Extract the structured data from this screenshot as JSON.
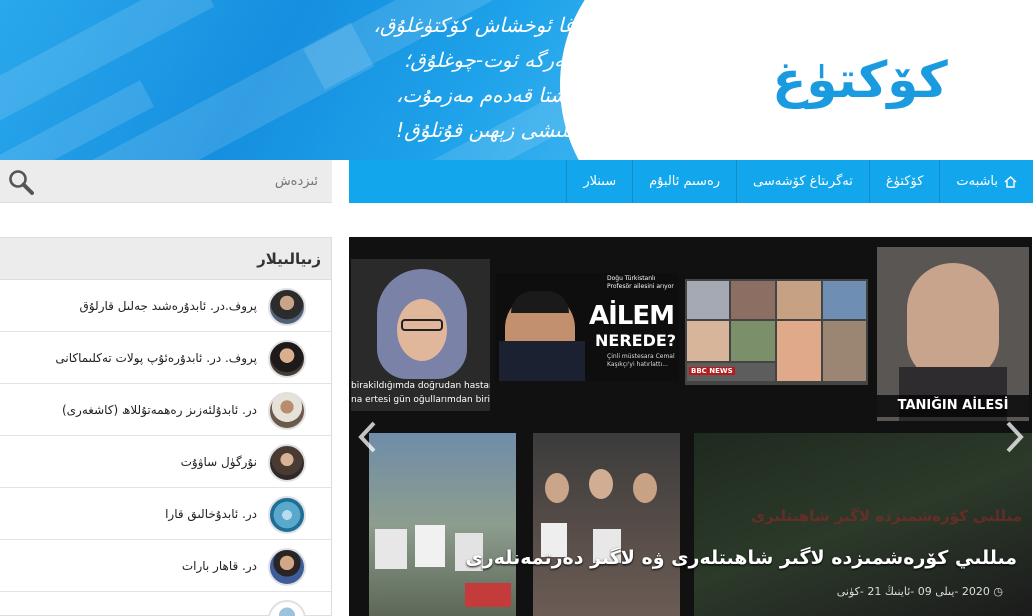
{
  "banner": {
    "poem": [
      "دېڭىزغا ئوخشاش كۆكتۈغلۇق،",
      "يۈرەكلەرگە ئوت-چوغلۇق؛",
      "ھەر ئىشتا قەدەم مەزمۇت،",
      "قوغچىلىشى زېھىن قۇتلۇق!"
    ],
    "logo": "كۆكتۈغ"
  },
  "search": {
    "placeholder": "ئىزدەش"
  },
  "nav": {
    "items": [
      "باشبەت",
      "كۆكتۈغ",
      "تەگرىتاغ كۆشەسى",
      "رەسىم ئالبۇم",
      "سىنلار"
    ],
    "home_icon": "home-icon"
  },
  "sidebar": {
    "title": "زىيالىيلار",
    "people": [
      "پروف.در. ئابدۇرەشىد جەلىل قارلۇق",
      "پروف. در. ئابدۇرەئۇپ پولات تەكلىماكانى",
      "در. ئابدۇلئەزىز رەھمەتۇللاھ (كاشغەرى)",
      "نۇرگۈل ساۋۇت",
      "در. ئابدۇخالىق قارا",
      "در. قاھار بارات"
    ]
  },
  "slider": {
    "tile_texts": {
      "t1_line1": "birakildığımda doğrudan hastane",
      "t1_line2": "na ertesi gün oğullarımdan biri öl",
      "t2_top": "Doğu Türkistanlı Profesör ailesini arıyor",
      "t2_big1": "AİLEM",
      "t2_big2": "NEREDE?",
      "t2_small": "Çinli müstesara Cemal Kaşıkçı'yi hatırlattı...",
      "t3_bbc": "BBC NEWS",
      "t4_banner": "TANIĞIN AİLESİ"
    },
    "ghost_text": "مىللىي كۆرەشمىزدە لاگىر شاھىتلىرى",
    "caption": "مىللىي كۆرەشمىزدە لاگىر شاھىتلەرى ۋە لاگىر دەرتمەنلەرى",
    "date": "2020 -يىلى 09 -ئاينىڭ 21 -كۈنى",
    "prev_icon": "chevron-left-icon",
    "next_icon": "chevron-right-icon",
    "clock_icon": "clock-icon"
  }
}
